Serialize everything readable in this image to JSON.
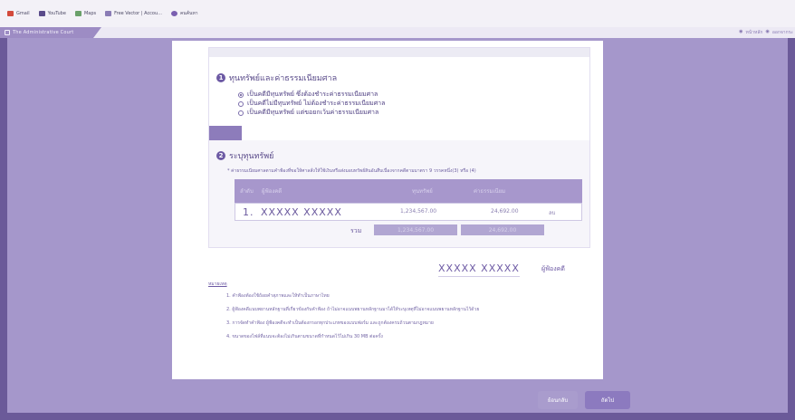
{
  "bookmarks": [
    {
      "label": "Gmail",
      "color": "#d34a3c"
    },
    {
      "label": "YouTube",
      "color": "#5a4b8a"
    },
    {
      "label": "Maps",
      "color": "#6aa06a"
    },
    {
      "label": "Free Vector | Accou...",
      "color": "#8a7cb5"
    },
    {
      "label": "คนค้นหา",
      "color": "#7a5fb0"
    }
  ],
  "header": {
    "title": "The Administrative Court",
    "links": [
      "หน้าหลัก",
      "ออกจากระ"
    ]
  },
  "section1": {
    "number": "1",
    "title": "ทุนทรัพย์และค่าธรรมเนียมศาล",
    "options": [
      {
        "label": "เป็นคดีมีทุนทรัพย์ ซึ่งต้องชำระค่าธรรมเนียมศาล",
        "selected": true
      },
      {
        "label": "เป็นคดีไม่มีทุนทรัพย์ ไม่ต้องชำระค่าธรรมเนียมศาล",
        "selected": false
      },
      {
        "label": "เป็นคดีมีทุนทรัพย์ แต่ขอยกเว้นค่าธรรมเนียมศาล",
        "selected": false
      }
    ]
  },
  "section2": {
    "number": "2",
    "title": "ระบุทุนทรัพย์",
    "note": "* ค่าธรรมเนียมศาลตามคำฟ้องที่ขอให้ศาลสั่งให้ใช้เงินหรือส่งมอบทรัพย์สินอันสืบเนื่องจากคดีตามมาตรา 9 วรรคหนึ่ง(3) หรือ (4)",
    "table": {
      "headers": [
        "ลำดับ",
        "ผู้ฟ้องคดี",
        "ทุนทรัพย์",
        "ค่าธรรมเนียม"
      ],
      "rows": [
        {
          "no": "1.",
          "name": "XXXXX  XXXXX",
          "amount": "1,234,567.00",
          "fee": "24,692.00",
          "action": "ลบ"
        }
      ],
      "total_label": "รวม",
      "total_amount": "1,234,567.00",
      "total_fee": "24,692.00"
    }
  },
  "signature": {
    "name": "XXXXX  XXXXX",
    "role": "ผู้ฟ้องคดี"
  },
  "remarks": {
    "title": "หมายเหตุ",
    "items": [
      "1. คำฟ้องต้องใช้ถ้อยคำสุภาพและให้ทำเป็นภาษาไทย",
      "2. ผู้ฟ้องคดีแนบพยานหลักฐานที่เกี่ยวข้องกับคำฟ้อง ถ้าไม่อาจแนบพยานหลักฐานมาได้ให้ระบุเหตุที่ไม่อาจแนบพยานหลักฐานไว้ด้วย",
      "3. การจัดทำคำฟ้อง ผู้ฟ้องคดีจะทำเป็นต้องกรอกทุกประเภทของแบบฟอร์ม และถูกต้องครบถ้วนตามกฎหมาย",
      "4. ขนาดของไฟล์ที่แนบจะต้องไม่เกินตามขนาดที่กำหนดไว้ไม่เกิน 30 MB ต่อครั้ง"
    ]
  },
  "buttons": {
    "back": "ย้อนกลับ",
    "next": "ถัดไป"
  }
}
